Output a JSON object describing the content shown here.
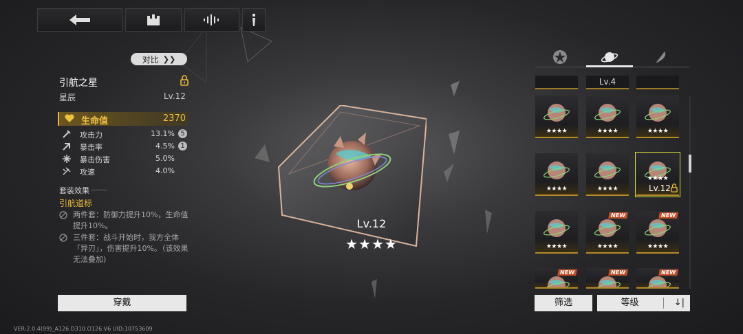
{
  "nav": {
    "back_icon": "back-arrow-icon",
    "home_icon": "castle-icon",
    "sound_icon": "waveform-icon",
    "info_icon": "info-icon"
  },
  "left": {
    "compare_label": "对比",
    "item_name": "引航之星",
    "item_type": "星辰",
    "item_level": "Lv.12",
    "main_stat": {
      "label": "生命值",
      "value": "2370"
    },
    "stats": [
      {
        "label": "攻击力",
        "value": "13.1%",
        "rank": "5"
      },
      {
        "label": "暴击率",
        "value": "4.5%",
        "rank": "1"
      },
      {
        "label": "暴击伤害",
        "value": "5.0%",
        "rank": ""
      },
      {
        "label": "攻速",
        "value": "4.0%",
        "rank": ""
      }
    ],
    "set_title": "套装效果",
    "set_name": "引航道标",
    "set_two": "两件套：防御力提升10%，生命值提升10%。",
    "set_three": "三件套：战斗开始时，我方全体「异刃」，伤害提升10%。（该效果无法叠加)",
    "equip_label": "穿戴"
  },
  "center": {
    "level": "Lv.12",
    "stars": "★★★★"
  },
  "right": {
    "tabs": [
      "flower-icon",
      "planet-icon",
      "feather-icon"
    ],
    "col_heads": [
      "",
      "Lv.4",
      ""
    ],
    "cards": [
      {
        "stars": "★★★★",
        "new": "",
        "level": ""
      },
      {
        "stars": "★★★★",
        "new": "",
        "level": ""
      },
      {
        "stars": "★★★★",
        "new": "",
        "level": ""
      },
      {
        "stars": "★★★★",
        "new": "",
        "level": ""
      },
      {
        "stars": "★★★★",
        "new": "",
        "level": ""
      },
      {
        "stars": "★★★★",
        "new": "",
        "level": "Lv.12"
      },
      {
        "stars": "★★★★",
        "new": "",
        "level": ""
      },
      {
        "stars": "★★★★",
        "new": "NEW",
        "level": ""
      },
      {
        "stars": "★★★★",
        "new": "NEW",
        "level": ""
      },
      {
        "stars": "",
        "new": "NEW",
        "level": ""
      },
      {
        "stars": "",
        "new": "NEW",
        "level": ""
      },
      {
        "stars": "",
        "new": "NEW",
        "level": ""
      }
    ],
    "filter_label": "筛选",
    "sort_label": "等级",
    "sort_icon": "↓|"
  },
  "footer": "VER:2.0.4(99)_A126.D310.O126.V6   UID:10753609",
  "colors": {
    "accent": "#e9b93a",
    "select": "#d8df3a"
  }
}
